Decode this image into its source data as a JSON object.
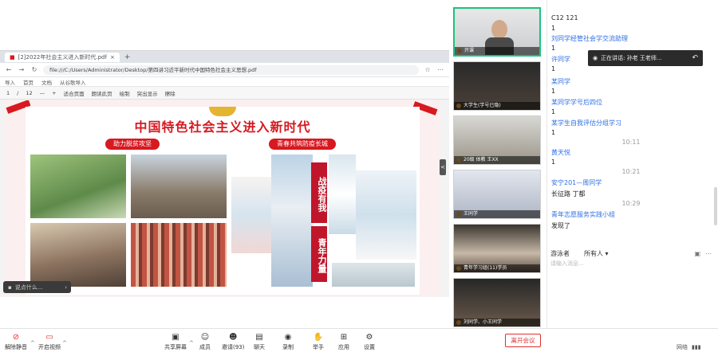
{
  "browser": {
    "tab_title": "[2]2022年社会主义进入新时代.pdf",
    "url": "file:///C:/Users/Administrator/Desktop/第四讲习近平新时代中国特色社会主义思想.pdf",
    "bookmarks": [
      "导入",
      "首页",
      "文档",
      "从谷歌导入"
    ],
    "pdf_toolbar": [
      "1",
      "/",
      "12",
      "—",
      "+",
      "适合页面",
      "朗读此页",
      "绘制",
      "突出显示",
      "擦除"
    ]
  },
  "slide": {
    "title": "中国特色社会主义进入新时代",
    "pill_left": "助力脱贫攻坚",
    "pill_right": "青春共筑防疫长城",
    "vertical_1": "战疫有我",
    "vertical_2": "青年力量"
  },
  "overlay": {
    "chat_float_label": "说点什么...",
    "side_toggle": "<"
  },
  "videos": [
    {
      "name": "开课"
    },
    {
      "name": "大学生(学号已隐)"
    },
    {
      "name": "20级 体教 王XX"
    },
    {
      "name": "王同学"
    },
    {
      "name": "青年学习组(11)学员"
    },
    {
      "name": "刘同学、小王同学"
    }
  ],
  "chat": {
    "messages": [
      {
        "text": "C12 121",
        "style": "plain"
      },
      {
        "text": "1",
        "style": "plain"
      },
      {
        "text": "刘同学经管社会学交流助理",
        "style": "link"
      },
      {
        "text": "1",
        "style": "plain"
      },
      {
        "text": "许同学",
        "style": "link"
      },
      {
        "text": "1",
        "style": "plain"
      },
      {
        "text": "某同学",
        "style": "link"
      },
      {
        "text": "1",
        "style": "plain"
      },
      {
        "text": "某同学学号后四位",
        "style": "link"
      },
      {
        "text": "1",
        "style": "plain"
      },
      {
        "text": "某学生自我评估分组学习",
        "style": "link"
      },
      {
        "text": "1",
        "style": "plain"
      },
      {
        "text": "10:11",
        "style": "time"
      },
      {
        "text": "黄天悦",
        "style": "link"
      },
      {
        "text": "1",
        "style": "plain"
      },
      {
        "text": "10:21",
        "style": "time"
      },
      {
        "text": "安宁201—周同学",
        "style": "link"
      },
      {
        "text": "长征路   丁都",
        "style": "plain"
      },
      {
        "text": "10:29",
        "style": "time"
      },
      {
        "text": "青年志愿服务实践小组",
        "style": "link"
      },
      {
        "text": "发现了",
        "style": "plain"
      }
    ],
    "speaking_label": "正在讲话: 孙老 王老师...",
    "input_sender": "游泳者",
    "input_recipient": "所有人",
    "input_placeholder": "请输入消息..."
  },
  "toolbar": {
    "buttons": [
      "解除静音",
      "开启视频",
      "共享屏幕",
      "成员",
      "邀请(93)",
      "聊天",
      "录制",
      "举手",
      "应用",
      "设置"
    ],
    "end_label": "离开会议",
    "network_label": "网络"
  }
}
